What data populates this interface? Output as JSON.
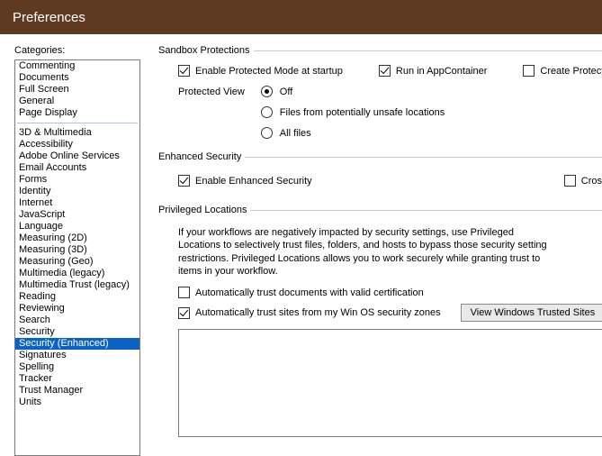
{
  "window": {
    "title": "Preferences"
  },
  "sidebar": {
    "label": "Categories:",
    "group1": [
      "Commenting",
      "Documents",
      "Full Screen",
      "General",
      "Page Display"
    ],
    "group2": [
      "3D & Multimedia",
      "Accessibility",
      "Adobe Online Services",
      "Email Accounts",
      "Forms",
      "Identity",
      "Internet",
      "JavaScript",
      "Language",
      "Measuring (2D)",
      "Measuring (3D)",
      "Measuring (Geo)",
      "Multimedia (legacy)",
      "Multimedia Trust (legacy)",
      "Reading",
      "Reviewing",
      "Search",
      "Security",
      "Security (Enhanced)",
      "Signatures",
      "Spelling",
      "Tracker",
      "Trust Manager",
      "Units"
    ],
    "selected": "Security (Enhanced)"
  },
  "sandbox": {
    "legend": "Sandbox Protections",
    "protected_mode": "Enable Protected Mode at startup",
    "appcontainer": "Run in AppContainer",
    "create_log": "Create Protected Mode log fil",
    "protected_view_label": "Protected View",
    "pv_off": "Off",
    "pv_unsafe": "Files from potentially unsafe locations",
    "pv_all": "All files"
  },
  "enhanced": {
    "legend": "Enhanced Security",
    "enable": "Enable Enhanced Security",
    "cross": "Cros"
  },
  "privileged": {
    "legend": "Privileged Locations",
    "desc": "If your workflows are negatively impacted by security settings, use Privileged Locations to selectively trust files, folders, and hosts to bypass those security setting restrictions. Privileged Locations allows you to work securely while granting trust to items in your workflow.",
    "auto_trust_cert": "Automatically trust documents with valid certification",
    "auto_trust_sites": "Automatically trust sites from my Win OS security zones",
    "view_sites_btn": "View Windows Trusted Sites"
  }
}
